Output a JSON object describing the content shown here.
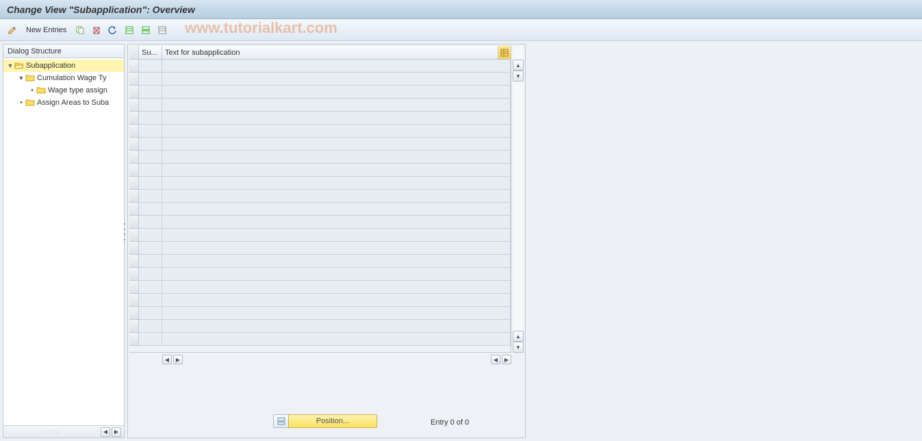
{
  "title": "Change View \"Subapplication\": Overview",
  "toolbar": {
    "new_entries": "New Entries"
  },
  "watermark": "www.tutorialkart.com",
  "left_panel": {
    "header": "Dialog Structure",
    "tree": [
      {
        "label": "Subapplication",
        "selected": true,
        "open": true
      },
      {
        "label": "Cumulation Wage Ty"
      },
      {
        "label": "Wage type assign"
      },
      {
        "label": "Assign Areas to Suba"
      }
    ]
  },
  "table": {
    "col_su": "Su...",
    "col_text": "Text for subapplication"
  },
  "footer": {
    "position": "Position...",
    "entry_status": "Entry 0 of 0"
  }
}
